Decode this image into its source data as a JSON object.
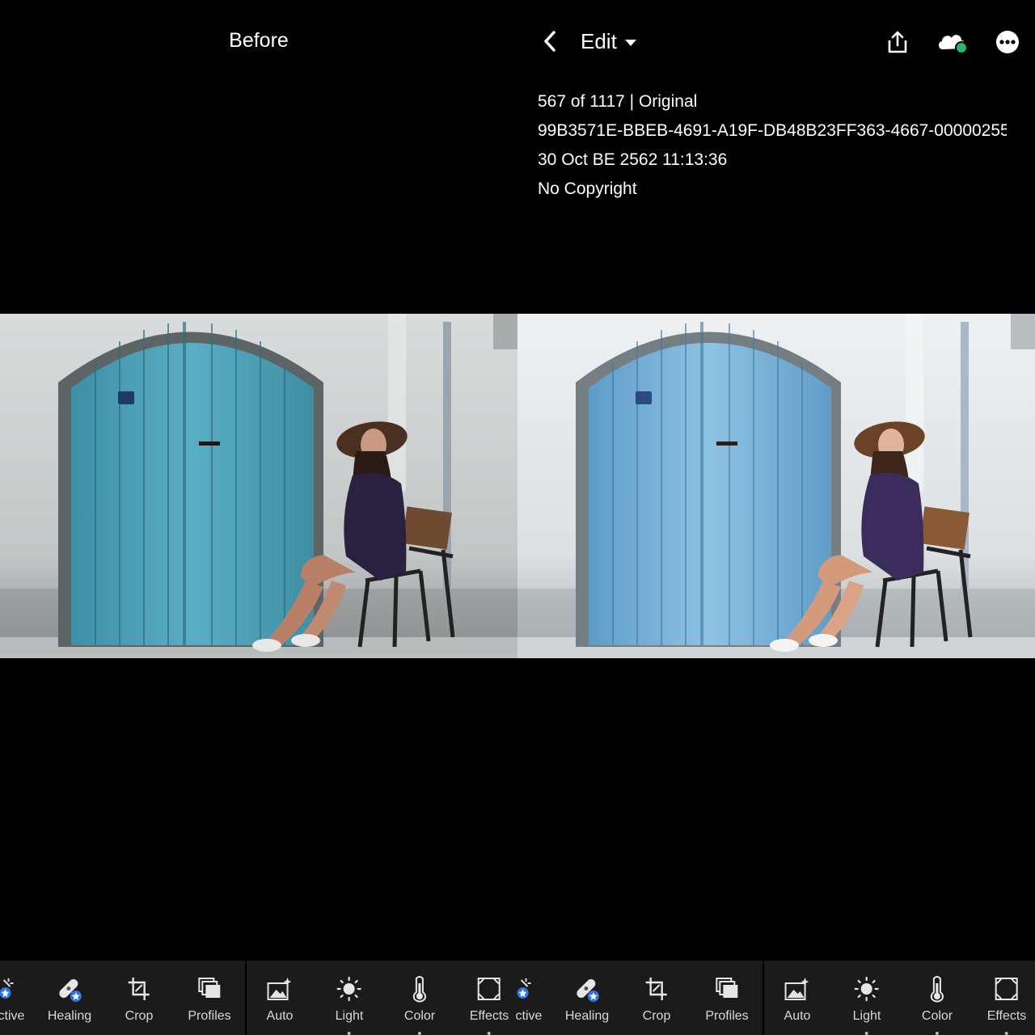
{
  "header": {
    "before_label": "Before",
    "edit_label": "Edit"
  },
  "info": {
    "count": "567 of 1117 | Original",
    "filename": "99B3571E-BBEB-4691-A19F-DB48B23FF363-4667-00000255...",
    "datetime": "30 Oct BE 2562 11:13:36",
    "copyright": "No Copyright"
  },
  "colors": {
    "sync_dot": "#27b567",
    "badge_blue": "#2b74e8",
    "toolbar_bg": "#1b1b1b"
  },
  "toolbar": {
    "left": [
      "ctive",
      "Healing",
      "Crop",
      "Profiles",
      "Auto",
      "Light",
      "Color",
      "Effects"
    ],
    "right": [
      "ctive",
      "Healing",
      "Crop",
      "Profiles",
      "Auto",
      "Light",
      "Color",
      "Effects"
    ]
  }
}
